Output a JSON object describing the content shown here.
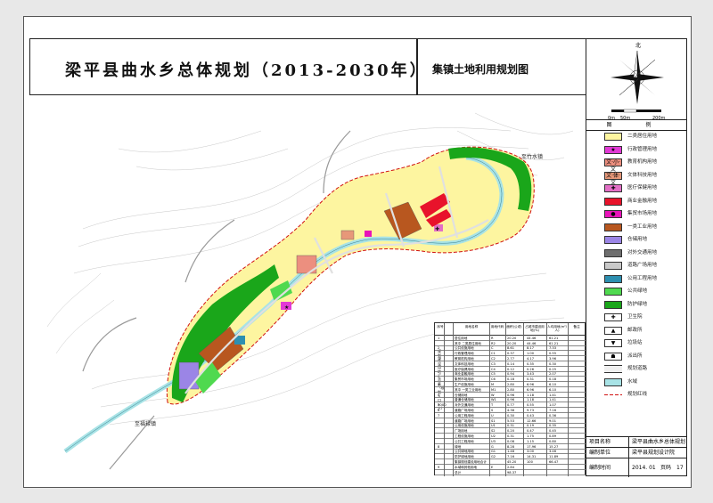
{
  "title": {
    "main": "梁平县曲水乡总体规划（2013-2030年）",
    "sub": "集镇土地利用规划图"
  },
  "compass": {
    "north": "北",
    "scale": [
      "0m",
      "50m",
      "200m"
    ]
  },
  "legend": {
    "title": "图 例",
    "items": [
      {
        "label": "二类居住用地",
        "color": "#fdf5a0",
        "symbol": ""
      },
      {
        "label": "行政管理用地",
        "color": "#e23ad6",
        "symbol": "★"
      },
      {
        "label": "教育机构用地",
        "color": "#ec8f7f",
        "symbol": "文·小·文"
      },
      {
        "label": "文体科技用地",
        "color": "#e79879",
        "symbol": "文·体·文"
      },
      {
        "label": "医疗保健用地",
        "color": "#e36fc6",
        "symbol": "✚"
      },
      {
        "label": "商业金融用地",
        "color": "#e8132b",
        "symbol": ""
      },
      {
        "label": "集贸市场用地",
        "color": "#e814b9",
        "symbol": "●"
      },
      {
        "label": "一类工业用地",
        "color": "#b8571f",
        "symbol": ""
      },
      {
        "label": "仓储用地",
        "color": "#9b85e6",
        "symbol": ""
      },
      {
        "label": "对外交通用地",
        "color": "#6e6e6e",
        "symbol": ""
      },
      {
        "label": "道路广场用地",
        "color": "#c9c9c9",
        "symbol": ""
      },
      {
        "label": "公用工程用地",
        "color": "#2d8fb0",
        "symbol": ""
      },
      {
        "label": "公共绿地",
        "color": "#4fd94f",
        "symbol": ""
      },
      {
        "label": "防护绿地",
        "color": "#1aa61a",
        "symbol": ""
      },
      {
        "label": "卫生院",
        "color": "#ffffff",
        "symbol": "✚"
      },
      {
        "label": "邮政所",
        "color": "#ffffff",
        "symbol": "▲"
      },
      {
        "label": "垃圾站",
        "color": "#ffffff",
        "symbol": "▼"
      },
      {
        "label": "派出所",
        "color": "#ffffff",
        "symbol": "☗"
      },
      {
        "label": "规划道路",
        "color": "#ffffff",
        "symbol": "road"
      },
      {
        "label": "水域",
        "color": "#a8e3e6",
        "symbol": ""
      },
      {
        "label": "规划红线",
        "color": "#ffffff",
        "symbol": "redline"
      }
    ]
  },
  "towns": {
    "northeast": "至竹水镇",
    "southwest": "至福禄镇"
  },
  "table": {
    "headers": [
      "序号",
      "用地名称",
      "用地代码",
      "面积(公顷)",
      "占城市建设用地(%)",
      "人均用地(m²/人)",
      "备注"
    ],
    "side_label": "规划建设用地汇总表（规划人口3000人）",
    "rows": [
      [
        "1",
        "居住用地",
        "R",
        "20.20",
        "44.46",
        "61.21"
      ],
      [
        "",
        "其中 二类居住用地",
        "R2",
        "20.20",
        "44.46",
        "61.21"
      ],
      [
        "2",
        "公共设施用地",
        "C",
        "8.61",
        "8.17",
        "7.33"
      ],
      [
        "",
        "行政管理用地",
        "C1",
        "0.37",
        "1.00",
        "0.55"
      ],
      [
        "",
        "教育机构用地",
        "C2",
        "2.77",
        "4.17",
        "3.96"
      ],
      [
        "",
        "文体科技用地",
        "C3",
        "0.14",
        "0.35",
        "0.30"
      ],
      [
        "",
        "医疗保健用地",
        "C4",
        "0.12",
        "0.26",
        "0.25"
      ],
      [
        "",
        "商业金融用地",
        "C5",
        "0.94",
        "3.43",
        "2.07"
      ],
      [
        "",
        "集贸市场用地",
        "C6",
        "0.18",
        "0.31",
        "0.18"
      ],
      [
        "3",
        "生产设施用地",
        "M",
        "2.80",
        "6.96",
        "6.10"
      ],
      [
        "",
        "其中 一类工业用地",
        "M1",
        "2.80",
        "6.96",
        "6.10"
      ],
      [
        "4",
        "仓储用地",
        "W",
        "0.96",
        "1.18",
        "1.41"
      ],
      [
        "",
        "普通仓储用地",
        "W1",
        "0.96",
        "1.18",
        "1.41"
      ],
      [
        "5",
        "对外交通用地",
        "T",
        "0.77",
        "0.55",
        "1.07"
      ],
      [
        "6",
        "道路广场用地",
        "S",
        "4.38",
        "9.73",
        "7.16"
      ],
      [
        "7",
        "公用工程用地",
        "U",
        "0.30",
        "0.43",
        "0.36"
      ],
      [
        "",
        "道路广场用地",
        "S1",
        "5.53",
        "12.66",
        "9.01"
      ],
      [
        "",
        "公用设施用地",
        "U1",
        "0.31",
        "0.19",
        "0.35"
      ],
      [
        "",
        "广场用地",
        "S2",
        "0.20",
        "0.47",
        "0.45"
      ],
      [
        "",
        "工程设施用地",
        "U2",
        "0.31",
        "1.75",
        "0.89"
      ],
      [
        "",
        "公共工程用地",
        "U3",
        "0.08",
        "1.15",
        "0.80"
      ],
      [
        "8",
        "绿地",
        "G",
        "8.28",
        "17.96",
        "15.27"
      ],
      [
        "",
        "公共绿地用地",
        "G1",
        "1.48",
        "3.00",
        "3.46"
      ],
      [
        "",
        "防护绿地用地",
        "G2",
        "7.16",
        "14.31",
        "11.89"
      ],
      [
        "",
        "集镇规划建设用地合计",
        "",
        "45.20",
        "100",
        "66.47"
      ],
      [
        "9",
        "水域和其他用地",
        "E",
        "2.84",
        "",
        ""
      ],
      [
        "",
        "总计",
        "",
        "98.37",
        "",
        ""
      ]
    ]
  },
  "info": {
    "project_label": "项目名称",
    "project_value": "梁平县曲水乡总体规划",
    "unit_label": "编制单位",
    "unit_value": "梁平县规划设计院",
    "time_label": "编制时间",
    "time_value": "2014. 01",
    "page_label": "页码",
    "page_value": "17"
  }
}
